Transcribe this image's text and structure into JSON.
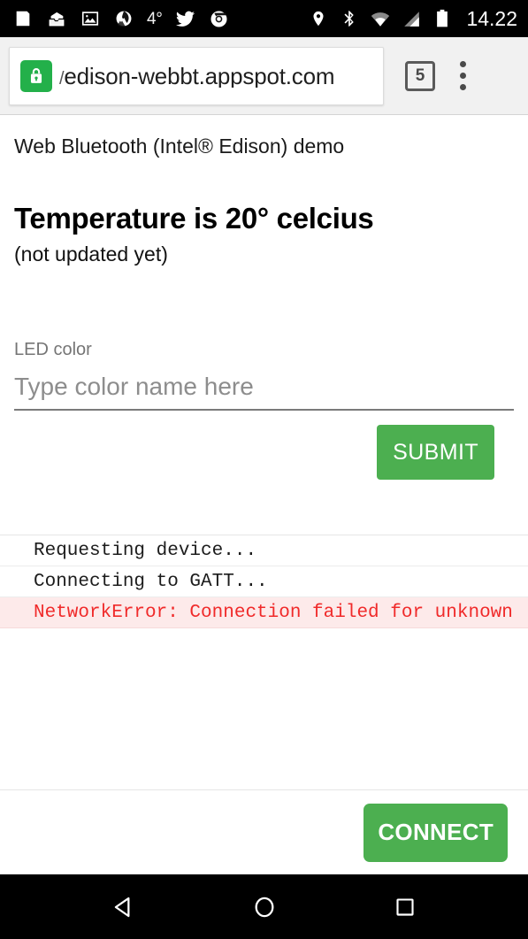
{
  "statusbar": {
    "left_icons": [
      {
        "name": "news-feed-icon",
        "glyph": "feed"
      },
      {
        "name": "inbox-mail-icon",
        "glyph": "inbox"
      },
      {
        "name": "photo-image-icon",
        "glyph": "photo"
      },
      {
        "name": "weather-mountain-icon",
        "glyph": "mountain"
      }
    ],
    "temperature": "4°",
    "app_icons": [
      {
        "name": "twitter-icon",
        "glyph": "twitter"
      },
      {
        "name": "chrome-icon",
        "glyph": "chrome"
      }
    ],
    "system_icons": [
      {
        "name": "location-pin-icon",
        "glyph": "pin"
      },
      {
        "name": "bluetooth-icon",
        "glyph": "bluetooth"
      },
      {
        "name": "wifi-icon",
        "glyph": "wifi"
      },
      {
        "name": "cellular-signal-icon",
        "glyph": "signal"
      },
      {
        "name": "battery-icon",
        "glyph": "battery"
      }
    ],
    "clock": "14.22"
  },
  "browser": {
    "security_icon": "lock-icon",
    "url_prefix": "/",
    "url": "edison-webbt.appspot.com",
    "tab_count": "5",
    "menu_icon": "overflow-menu-icon"
  },
  "page": {
    "demo_title": "Web Bluetooth (Intel® Edison) demo",
    "temperature_heading": "Temperature is 20° celcius",
    "temperature_status": "(not updated yet)",
    "led_color": {
      "label": "LED color",
      "value": "",
      "placeholder": "Type color name here"
    },
    "submit_label": "SUBMIT",
    "connect_label": "CONNECT",
    "log": [
      {
        "text": "Requesting device...",
        "type": "info"
      },
      {
        "text": "Connecting to GATT...",
        "type": "info"
      },
      {
        "text": "NetworkError: Connection failed for unknown",
        "type": "error"
      }
    ]
  },
  "navigation": {
    "back": "back-button",
    "home": "home-button",
    "recents": "recents-button"
  },
  "colors": {
    "accent_green": "#4caf50",
    "lock_green": "#23b04a",
    "error_red": "#f02a2a",
    "error_bg": "#fdeaea"
  }
}
